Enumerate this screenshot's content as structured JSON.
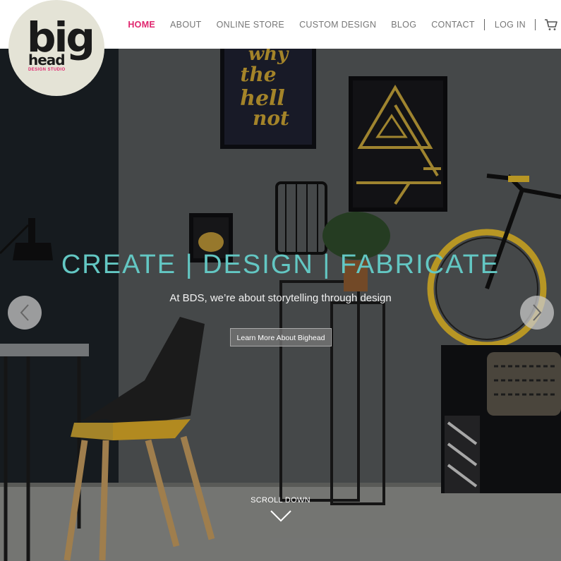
{
  "brand": {
    "logo_big": "big",
    "logo_head": "head",
    "logo_sub": "DESIGN STUDIO",
    "accent_color": "#e0266e"
  },
  "nav": {
    "items": [
      {
        "label": "HOME",
        "active": true
      },
      {
        "label": "ABOUT"
      },
      {
        "label": "ONLINE STORE"
      },
      {
        "label": "CUSTOM DESIGN"
      },
      {
        "label": "BLOG"
      },
      {
        "label": "CONTACT"
      }
    ],
    "login": "LOG IN",
    "cart_icon": "cart-icon"
  },
  "hero": {
    "headline": "CREATE | DESIGN | FABRICATE",
    "headline_color": "#63c7c3",
    "tagline": "At BDS, we’re about storytelling through design",
    "cta_label": "Learn More About Bighead",
    "poster_text": [
      "why",
      "the",
      "hell",
      "not"
    ],
    "scroll_label": "SCROLL DOWN",
    "prev_icon": "chevron-left-icon",
    "next_icon": "chevron-right-icon"
  }
}
